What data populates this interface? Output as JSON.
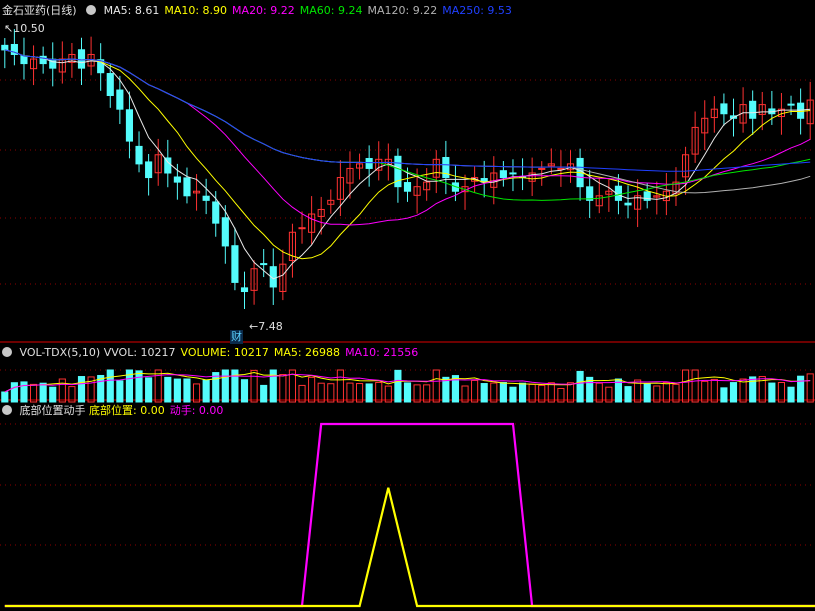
{
  "title": "金石亚药(日线)",
  "colors": {
    "bg": "#000000",
    "up": "#ff3232",
    "down": "#54fcfc",
    "grid": "#8b0000",
    "axis": "#b0b0b0",
    "ma5": "#e8e8e8",
    "ma10": "#ffff00",
    "ma20": "#ff00ff",
    "ma60": "#00e600",
    "ma120": "#b0b0b0",
    "ma250": "#2040ff"
  },
  "price_panel": {
    "legend": [
      {
        "key": "ma5",
        "label": "MA5:",
        "value": "8.61"
      },
      {
        "key": "ma10",
        "label": "MA10:",
        "value": "8.90"
      },
      {
        "key": "ma20",
        "label": "MA20:",
        "value": "9.22"
      },
      {
        "key": "ma60",
        "label": "MA60:",
        "value": "9.24"
      },
      {
        "key": "ma120",
        "label": "MA120:",
        "value": "9.22"
      },
      {
        "key": "ma250",
        "label": "MA250:",
        "value": "9.53"
      }
    ],
    "high_marker": "10.50",
    "low_marker": "7.48",
    "event_marker": "财"
  },
  "vol_panel": {
    "indicator": "VOL-TDX(5,10)",
    "items": [
      {
        "key": "vvol",
        "label": "VVOL:",
        "value": "10217"
      },
      {
        "key": "volume",
        "label": "VOLUME:",
        "value": "10217"
      },
      {
        "key": "ma5",
        "label": "MA5:",
        "value": "26988"
      },
      {
        "key": "ma10",
        "label": "MA10:",
        "value": "21556"
      }
    ]
  },
  "ind_panel": {
    "indicator": "底部位置动手",
    "items": [
      {
        "key": "bottom",
        "label": "底部位置:",
        "value": "0.00"
      },
      {
        "key": "act",
        "label": "动手:",
        "value": "0.00"
      }
    ]
  },
  "chart_data": {
    "type": "candlestick",
    "price_range": [
      7.3,
      10.7
    ],
    "closes": [
      10.35,
      10.3,
      10.2,
      10.25,
      10.2,
      10.15,
      10.25,
      10.3,
      10.15,
      10.3,
      10.1,
      9.85,
      9.7,
      9.35,
      9.1,
      8.95,
      9.2,
      9.0,
      8.9,
      8.75,
      8.8,
      8.7,
      8.45,
      8.2,
      7.8,
      7.7,
      7.95,
      8.0,
      7.75,
      8.0,
      8.35,
      8.4,
      8.55,
      8.6,
      8.7,
      8.95,
      9.05,
      9.1,
      9.05,
      9.15,
      9.15,
      8.85,
      8.8,
      8.85,
      8.9,
      9.15,
      8.95,
      8.8,
      8.85,
      8.95,
      8.9,
      9.0,
      8.95,
      9.0,
      8.95,
      9.0,
      9.05,
      9.1,
      9.05,
      9.1,
      8.85,
      8.7,
      8.75,
      8.8,
      8.7,
      8.65,
      8.75,
      8.7,
      8.75,
      8.8,
      8.9,
      9.2,
      9.5,
      9.6,
      9.7,
      9.65,
      9.6,
      9.75,
      9.6,
      9.75,
      9.65,
      9.7,
      9.75,
      9.6,
      9.8
    ],
    "bottom_signal": [
      [
        0,
        0
      ],
      [
        37,
        0
      ],
      [
        40,
        0.65
      ],
      [
        43,
        0
      ],
      [
        85,
        0
      ]
    ],
    "act_signal": [
      [
        0,
        0
      ],
      [
        31,
        0
      ],
      [
        33,
        1
      ],
      [
        53,
        1
      ],
      [
        55,
        0
      ],
      [
        85,
        0
      ]
    ]
  }
}
